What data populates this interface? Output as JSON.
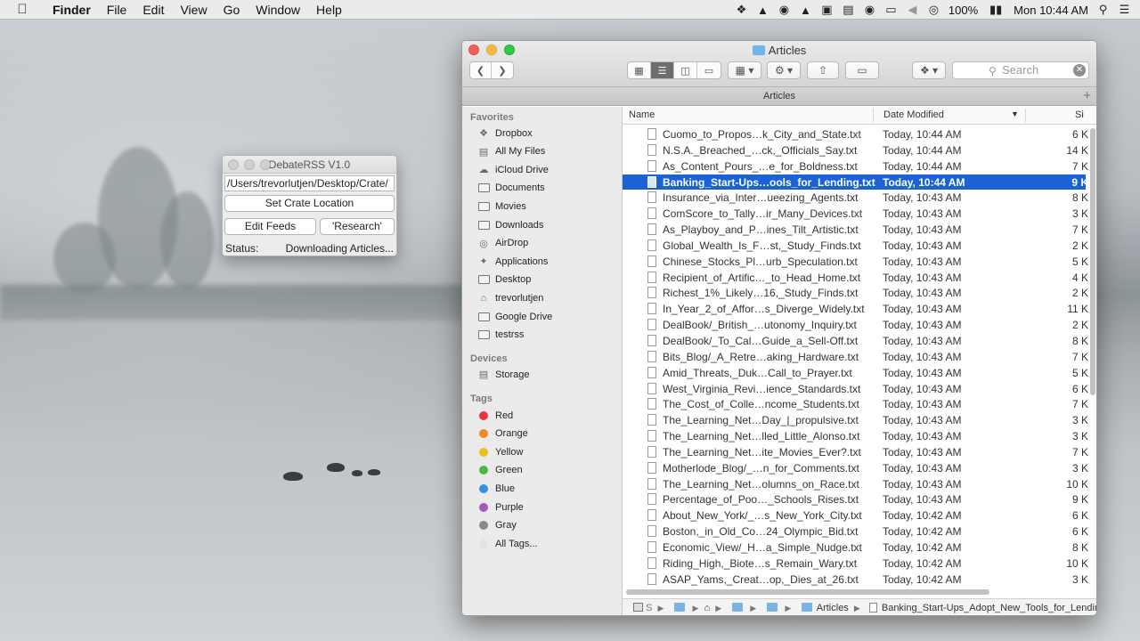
{
  "menubar": {
    "app": "Finder",
    "items": [
      "File",
      "Edit",
      "View",
      "Go",
      "Window",
      "Help"
    ],
    "battery": "100%",
    "clock": "Mon 10:44 AM"
  },
  "debaterss": {
    "title": "DebateRSS V1.0",
    "path": "/Users/trevorlutjen/Desktop/Crate/",
    "set_crate_label": "Set Crate Location",
    "edit_feeds_label": "Edit Feeds",
    "research_label": "'Research'",
    "status_label": "Status:",
    "status_value": "Downloading Articles..."
  },
  "finder": {
    "title": "Articles",
    "tab_label": "Articles",
    "search_placeholder": "Search",
    "columns": {
      "name": "Name",
      "date": "Date Modified",
      "size": "Si"
    },
    "sidebar": {
      "favorites_head": "Favorites",
      "favorites": [
        "Dropbox",
        "All My Files",
        "iCloud Drive",
        "Documents",
        "Movies",
        "Downloads",
        "AirDrop",
        "Applications",
        "Desktop",
        "trevorlutjen",
        "Google Drive",
        "testrss"
      ],
      "devices_head": "Devices",
      "devices": [
        "Storage"
      ],
      "tags_head": "Tags",
      "tags": [
        {
          "label": "Red",
          "color": "#e5383b"
        },
        {
          "label": "Orange",
          "color": "#f08a24"
        },
        {
          "label": "Yellow",
          "color": "#e7c21d"
        },
        {
          "label": "Green",
          "color": "#4cb848"
        },
        {
          "label": "Blue",
          "color": "#3b8fe0"
        },
        {
          "label": "Purple",
          "color": "#a35bc4"
        },
        {
          "label": "Gray",
          "color": "#8a8a8a"
        },
        {
          "label": "All Tags...",
          "color": "#e3e3e3"
        }
      ]
    },
    "selected_index": 3,
    "files": [
      {
        "name": "Cuomo_to_Propos…k_City_and_State.txt",
        "date": "Today, 10:44 AM",
        "size": "6 K"
      },
      {
        "name": "N.S.A._Breached_…ck,_Officials_Say.txt",
        "date": "Today, 10:44 AM",
        "size": "14 K"
      },
      {
        "name": "As_Content_Pours_…e_for_Boldness.txt",
        "date": "Today, 10:44 AM",
        "size": "7 K"
      },
      {
        "name": "Banking_Start-Ups…ools_for_Lending.txt",
        "date": "Today, 10:44 AM",
        "size": "9 K"
      },
      {
        "name": "Insurance_via_Inter…ueezing_Agents.txt",
        "date": "Today, 10:43 AM",
        "size": "8 K"
      },
      {
        "name": "ComScore_to_Tally…ir_Many_Devices.txt",
        "date": "Today, 10:43 AM",
        "size": "3 K"
      },
      {
        "name": "As_Playboy_and_P…ines_Tilt_Artistic.txt",
        "date": "Today, 10:43 AM",
        "size": "7 K"
      },
      {
        "name": "Global_Wealth_Is_F…st,_Study_Finds.txt",
        "date": "Today, 10:43 AM",
        "size": "2 K"
      },
      {
        "name": "Chinese_Stocks_Pl…urb_Speculation.txt",
        "date": "Today, 10:43 AM",
        "size": "5 K"
      },
      {
        "name": "Recipient_of_Artific…_to_Head_Home.txt",
        "date": "Today, 10:43 AM",
        "size": "4 K"
      },
      {
        "name": "Richest_1%_Likely…16,_Study_Finds.txt",
        "date": "Today, 10:43 AM",
        "size": "2 K"
      },
      {
        "name": "In_Year_2_of_Affor…s_Diverge_Widely.txt",
        "date": "Today, 10:43 AM",
        "size": "11 K"
      },
      {
        "name": "DealBook/_British_…utonomy_Inquiry.txt",
        "date": "Today, 10:43 AM",
        "size": "2 K"
      },
      {
        "name": "DealBook/_To_Cal…Guide_a_Sell-Off.txt",
        "date": "Today, 10:43 AM",
        "size": "8 K"
      },
      {
        "name": "Bits_Blog/_A_Retre…aking_Hardware.txt",
        "date": "Today, 10:43 AM",
        "size": "7 K"
      },
      {
        "name": "Amid_Threats,_Duk…Call_to_Prayer.txt",
        "date": "Today, 10:43 AM",
        "size": "5 K"
      },
      {
        "name": "West_Virginia_Revi…ience_Standards.txt",
        "date": "Today, 10:43 AM",
        "size": "6 K"
      },
      {
        "name": "The_Cost_of_Colle…ncome_Students.txt",
        "date": "Today, 10:43 AM",
        "size": "7 K"
      },
      {
        "name": "The_Learning_Net…Day_|_propulsive.txt",
        "date": "Today, 10:43 AM",
        "size": "3 K"
      },
      {
        "name": "The_Learning_Net…lled_Little_Alonso.txt",
        "date": "Today, 10:43 AM",
        "size": "3 K"
      },
      {
        "name": "The_Learning_Net…ite_Movies_Ever?.txt",
        "date": "Today, 10:43 AM",
        "size": "7 K"
      },
      {
        "name": "Motherlode_Blog/_…n_for_Comments.txt",
        "date": "Today, 10:43 AM",
        "size": "3 K"
      },
      {
        "name": "The_Learning_Net…olumns_on_Race.txt",
        "date": "Today, 10:43 AM",
        "size": "10 K"
      },
      {
        "name": "Percentage_of_Poo…_Schools_Rises.txt",
        "date": "Today, 10:43 AM",
        "size": "9 K"
      },
      {
        "name": "About_New_York/_…s_New_York_City.txt",
        "date": "Today, 10:42 AM",
        "size": "6 K"
      },
      {
        "name": "Boston,_in_Old_Co…24_Olympic_Bid.txt",
        "date": "Today, 10:42 AM",
        "size": "6 K"
      },
      {
        "name": "Economic_View/_H…a_Simple_Nudge.txt",
        "date": "Today, 10:42 AM",
        "size": "8 K"
      },
      {
        "name": "Riding_High,_Biote…s_Remain_Wary.txt",
        "date": "Today, 10:42 AM",
        "size": "10 K"
      },
      {
        "name": "ASAP_Yams,_Creat…op,_Dies_at_26.txt",
        "date": "Today, 10:42 AM",
        "size": "3 K"
      }
    ],
    "pathbar": {
      "crumb_first": "S",
      "folder": "Articles",
      "file": "Banking_Start-Ups_Adopt_New_Tools_for_Lending.txt"
    }
  }
}
